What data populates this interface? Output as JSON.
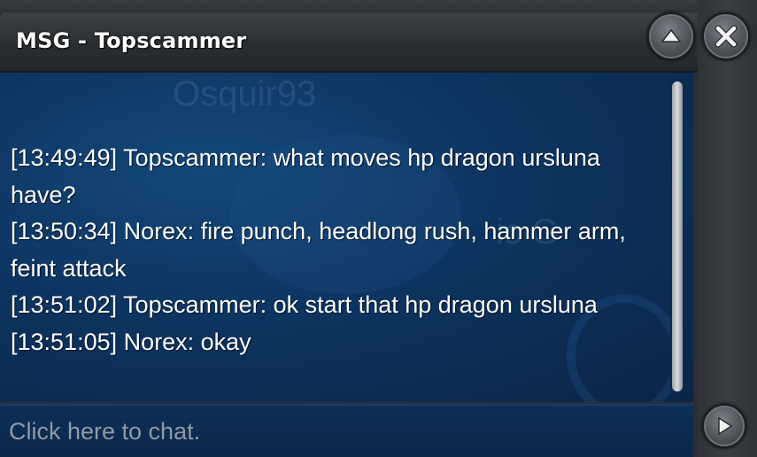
{
  "window": {
    "title": "MSG - Topscammer"
  },
  "buttons": {
    "collapse_icon": "chevron-up-icon",
    "close_icon": "close-icon",
    "send_icon": "play-arrow-icon"
  },
  "background_text": {
    "name": "Osquir93",
    "game": "ic G"
  },
  "messages": [
    "[13:49:49] Topscammer: what moves hp dragon ursluna have?",
    "[13:50:34] Norex: fire punch, headlong rush, hammer arm, feint attack",
    "[13:51:02] Topscammer: ok start that hp dragon ursluna",
    "[13:51:05] Norex: okay"
  ],
  "input": {
    "placeholder": "Click here to chat.",
    "value": ""
  },
  "colors": {
    "chat_background": "#0d3460",
    "text": "#ffffff",
    "placeholder": "#8f9aa6"
  }
}
